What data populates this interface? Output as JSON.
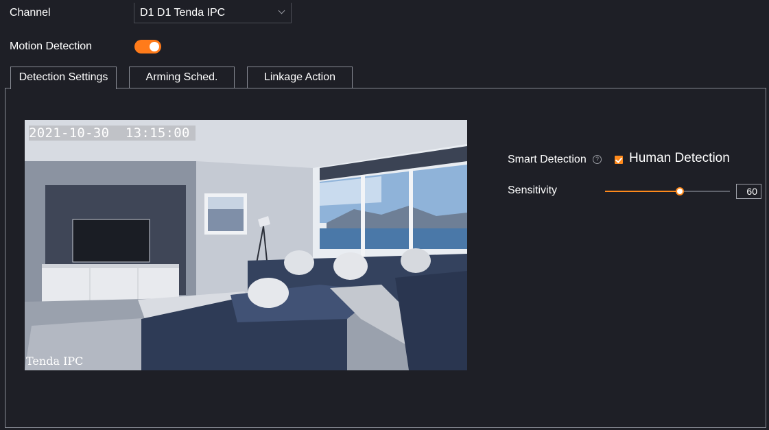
{
  "channel": {
    "label": "Channel",
    "selected": "D1 D1 Tenda IPC"
  },
  "motion_detection": {
    "label": "Motion Detection",
    "enabled": true
  },
  "tabs": [
    {
      "label": "Detection Settings",
      "active": true
    },
    {
      "label": "Arming Sched.",
      "active": false
    },
    {
      "label": "Linkage Action",
      "active": false
    }
  ],
  "preview": {
    "timestamp": "2021-10-30  13:15:00",
    "camera_name": "Tenda IPC"
  },
  "smart_detection": {
    "label": "Smart Detection",
    "help_icon": "question-circle-icon",
    "human_detection_label": "Human Detection",
    "human_detection_checked": true
  },
  "sensitivity": {
    "label": "Sensitivity",
    "value": "60",
    "level_fraction": 0.6
  },
  "colors": {
    "background": "#1e1f26",
    "accent": "#ff8a1c",
    "border": "#8a8d96"
  }
}
